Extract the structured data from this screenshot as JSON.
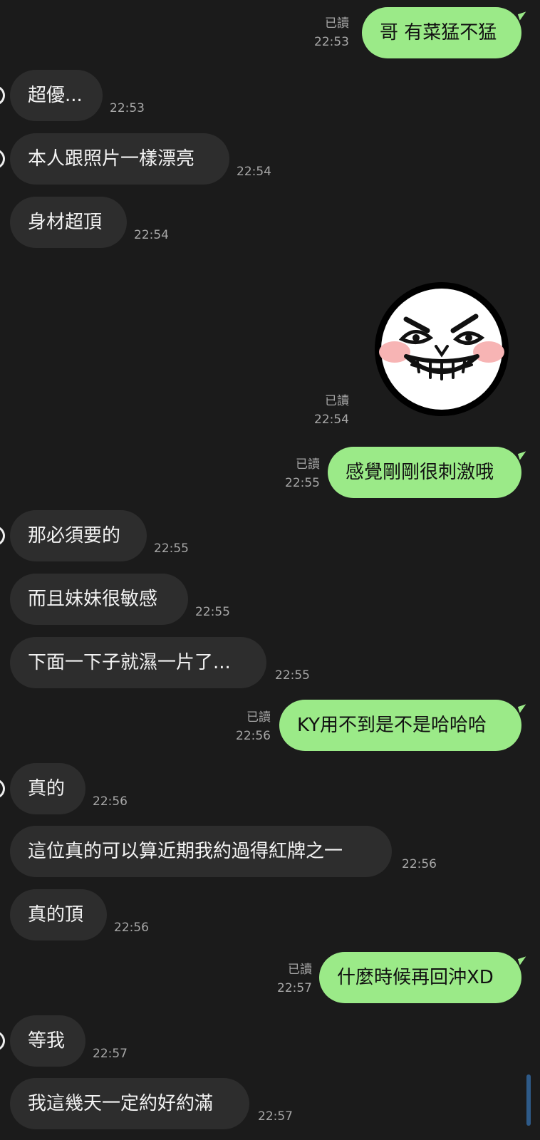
{
  "messages": [
    {
      "text": "哥 有菜猛不猛",
      "read": "已讀",
      "time": "22:53"
    },
    {
      "text": "超優...",
      "time": "22:53"
    },
    {
      "text": "本人跟照片一樣漂亮",
      "time": "22:54"
    },
    {
      "text": "身材超頂",
      "time": "22:54"
    },
    {
      "sticker": "laughing-moon-face-sticker",
      "read": "已讀",
      "time": "22:54"
    },
    {
      "text": "感覺剛剛很刺激哦",
      "read": "已讀",
      "time": "22:55"
    },
    {
      "text": "那必須要的",
      "time": "22:55"
    },
    {
      "text": "而且妹妹很敏感",
      "time": "22:55"
    },
    {
      "text": "下面一下子就濕一片了...",
      "time": "22:55"
    },
    {
      "text": "KY用不到是不是哈哈哈",
      "read": "已讀",
      "time": "22:56"
    },
    {
      "text": "真的",
      "time": "22:56"
    },
    {
      "text": "這位真的可以算近期我約過得紅牌之一",
      "time": "22:56"
    },
    {
      "text": "真的頂",
      "time": "22:56"
    },
    {
      "text": "什麼時候再回沖XD",
      "read": "已讀",
      "time": "22:57"
    },
    {
      "text": "等我",
      "time": "22:57"
    },
    {
      "text": "我這幾天一定約好約滿",
      "time": "22:57"
    }
  ],
  "colors": {
    "background": "#1b1b1b",
    "outgoing_bubble": "#9bea88",
    "incoming_bubble": "#2d2d2d",
    "meta_text": "#a7a7a7"
  }
}
